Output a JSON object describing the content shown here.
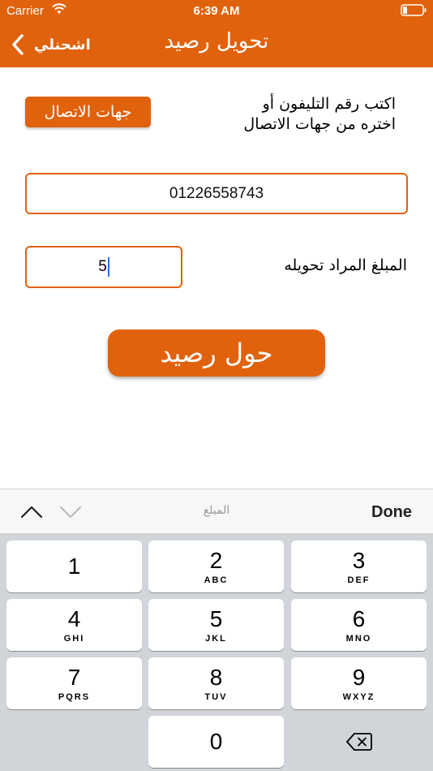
{
  "status_bar": {
    "carrier": "Carrier",
    "time": "6:39 AM",
    "icons": [
      "wifi-icon",
      "battery-icon"
    ]
  },
  "nav": {
    "back_label": "اشحنلي",
    "title": "تحويل رصيد"
  },
  "form": {
    "hint_line1": "اكتب رقم التليفون أو",
    "hint_line2": "اختره من جهات الاتصال",
    "contacts_button": "جهات الاتصال",
    "phone_value": "01226558743",
    "amount_label": "المبلغ المراد تحويله",
    "amount_value": "5",
    "transfer_button": "حول رصيد"
  },
  "keyboard_toolbar": {
    "field_name": "المبلغ",
    "done_label": "Done"
  },
  "keypad": {
    "keys": [
      {
        "digit": "1",
        "letters": ""
      },
      {
        "digit": "2",
        "letters": "ABC"
      },
      {
        "digit": "3",
        "letters": "DEF"
      },
      {
        "digit": "4",
        "letters": "GHI"
      },
      {
        "digit": "5",
        "letters": "JKL"
      },
      {
        "digit": "6",
        "letters": "MNO"
      },
      {
        "digit": "7",
        "letters": "PQRS"
      },
      {
        "digit": "8",
        "letters": "TUV"
      },
      {
        "digit": "9",
        "letters": "WXYZ"
      },
      {
        "digit": "0",
        "letters": ""
      }
    ]
  },
  "colors": {
    "accent": "#e0620c",
    "keypad_bg": "#d1d4d9",
    "cursor": "#1f6fe0"
  }
}
